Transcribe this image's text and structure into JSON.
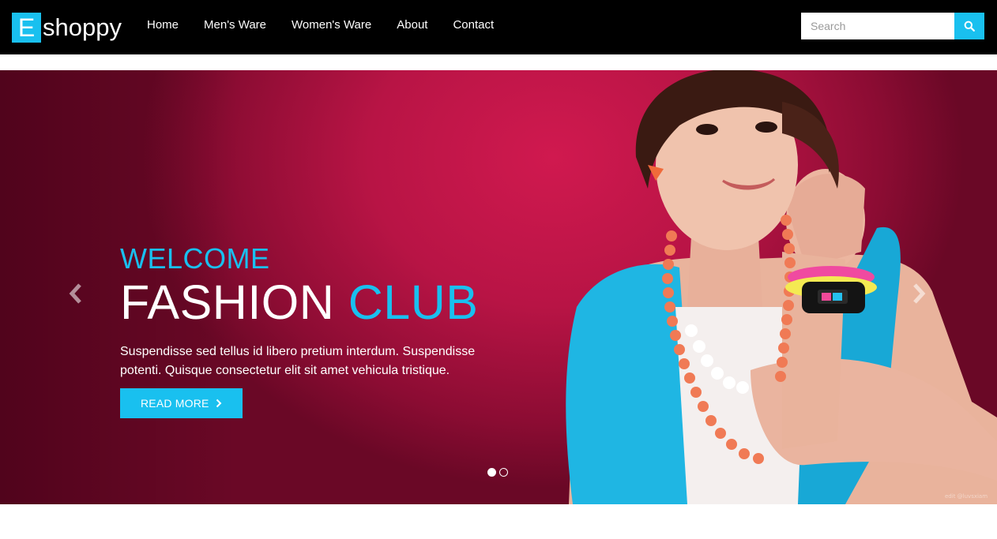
{
  "brand": {
    "first_letter": "E",
    "rest": "shoppy",
    "accent_color": "#19c0ef"
  },
  "nav": {
    "items": [
      {
        "label": "Home"
      },
      {
        "label": "Men's Ware"
      },
      {
        "label": "Women's Ware"
      },
      {
        "label": "About"
      },
      {
        "label": "Contact"
      }
    ]
  },
  "search": {
    "placeholder": "Search",
    "icon": "search-icon"
  },
  "hero": {
    "welcome": "WELCOME",
    "headline_main": "FASHION",
    "headline_accent": "CLUB",
    "description": "Suspendisse sed tellus id libero pretium interdum. Suspendisse potenti. Quisque consectetur elit sit amet vehicula tristique.",
    "button_label": "READ MORE",
    "button_icon": "chevron-right-icon",
    "prev_icon": "chevron-left-icon",
    "next_icon": "chevron-right-icon",
    "slides_total": 2,
    "active_slide": 1,
    "background_color": "#c4164a",
    "credit": "edit @luvsxiam"
  }
}
